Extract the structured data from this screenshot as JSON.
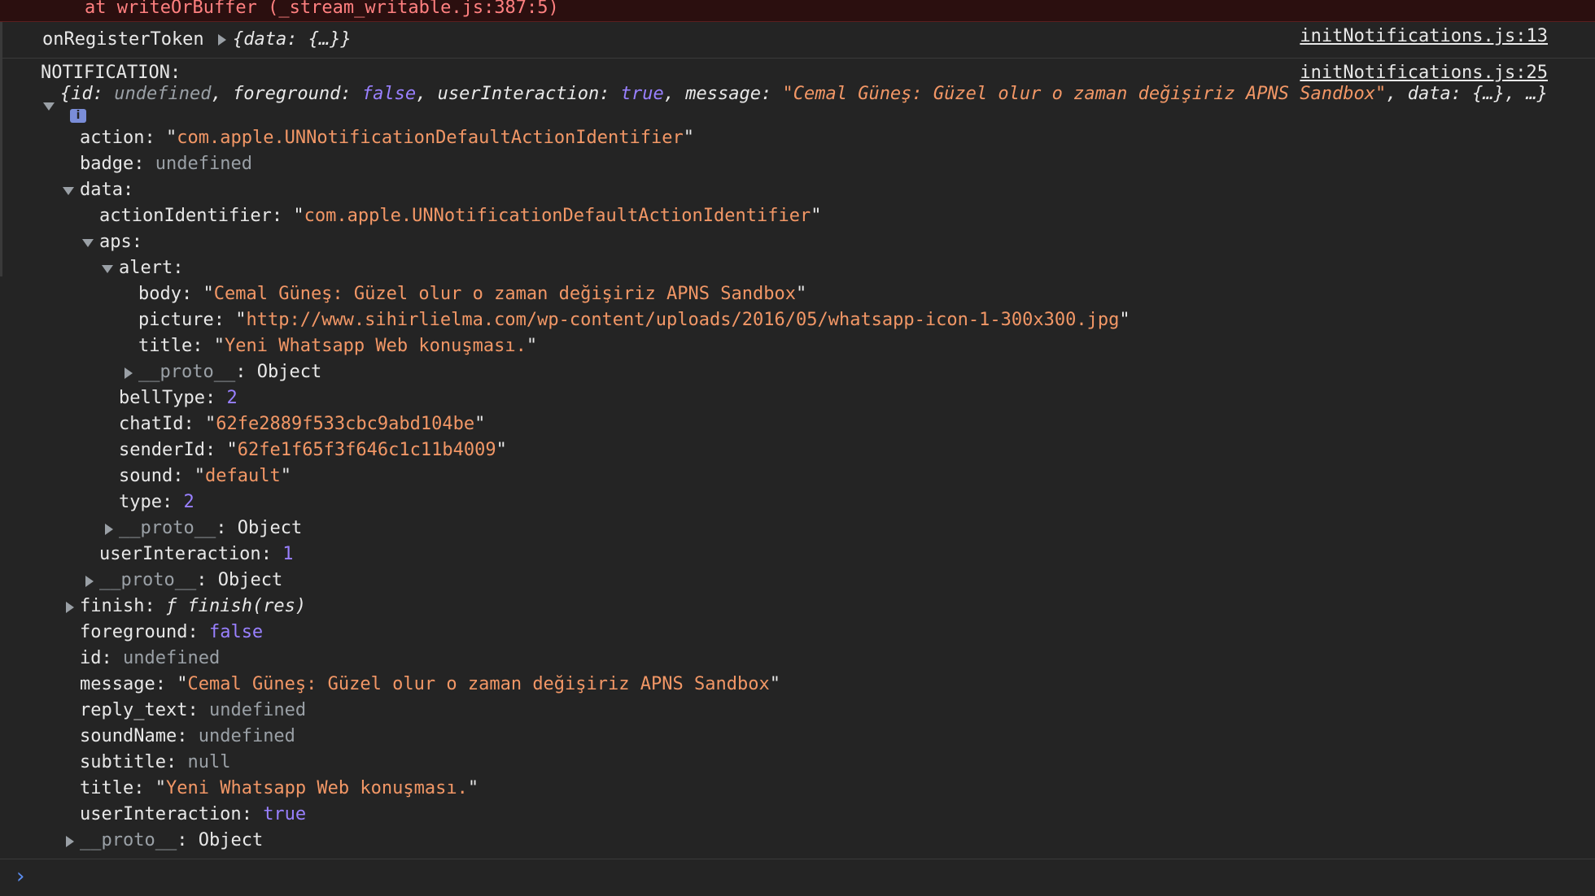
{
  "error_line": "at writeOrBuffer (_stream_writable.js:387:5)",
  "token_msg": {
    "label": "onRegisterToken",
    "preview": "{data: {…}}",
    "source": "initNotifications.js:13"
  },
  "notification": {
    "label": "NOTIFICATION:",
    "source": "initNotifications.js:25",
    "preview": {
      "open": "{",
      "id_key": "id: ",
      "id_val": "undefined",
      "fg_key": ", foreground: ",
      "fg_val": "false",
      "ui_key": ", userInteraction: ",
      "ui_val": "true",
      "msg_key": ", message: ",
      "msg_val": "\"Cemal Güneş: Güzel olur o zaman değişiriz APNS Sandbox\"",
      "tail": ", data: {…}, …}"
    },
    "badge": "i",
    "props": {
      "action_key": "action",
      "action_val": "com.apple.UNNotificationDefaultActionIdentifier",
      "badge_key": "badge",
      "badge_val": "undefined",
      "data_key": "data",
      "actionIdentifier_key": "actionIdentifier",
      "actionIdentifier_val": "com.apple.UNNotificationDefaultActionIdentifier",
      "aps_key": "aps",
      "alert_key": "alert",
      "body_key": "body",
      "body_val": "Cemal Güneş: Güzel olur o zaman değişiriz APNS Sandbox",
      "picture_key": "picture",
      "picture_val": "http://www.sihirlielma.com/wp-content/uploads/2016/05/whatsapp-icon-1-300x300.jpg",
      "title_key": "title",
      "title_val": "Yeni Whatsapp Web konuşması.",
      "proto_key": "__proto__",
      "proto_val": "Object",
      "bellType_key": "bellType",
      "bellType_val": "2",
      "chatId_key": "chatId",
      "chatId_val": "62fe2889f533cbc9abd104be",
      "senderId_key": "senderId",
      "senderId_val": "62fe1f65f3f646c1c11b4009",
      "sound_key": "sound",
      "sound_val": "default",
      "type_key": "type",
      "type_val": "2",
      "userInteraction_key": "userInteraction",
      "userInteraction_num": "1",
      "finish_key": "finish",
      "finish_val": "ƒ finish(res)",
      "foreground_key": "foreground",
      "foreground_val": "false",
      "id_key": "id",
      "id_val": "undefined",
      "message_key": "message",
      "message_val": "Cemal Güneş: Güzel olur o zaman değişiriz APNS Sandbox",
      "reply_text_key": "reply_text",
      "reply_text_val": "undefined",
      "soundName_key": "soundName",
      "soundName_val": "undefined",
      "subtitle_key": "subtitle",
      "subtitle_val": "null",
      "title2_val": "Yeni Whatsapp Web konuşması.",
      "userInteraction_bool": "true"
    }
  },
  "prompt": {
    "symbol": "›"
  },
  "colors": {
    "background": "#242424",
    "string": "#f29766",
    "keyword": "#9980ff",
    "undefined": "#9aa0a6",
    "error_text": "#ff8080",
    "prompt": "#5b8def"
  }
}
